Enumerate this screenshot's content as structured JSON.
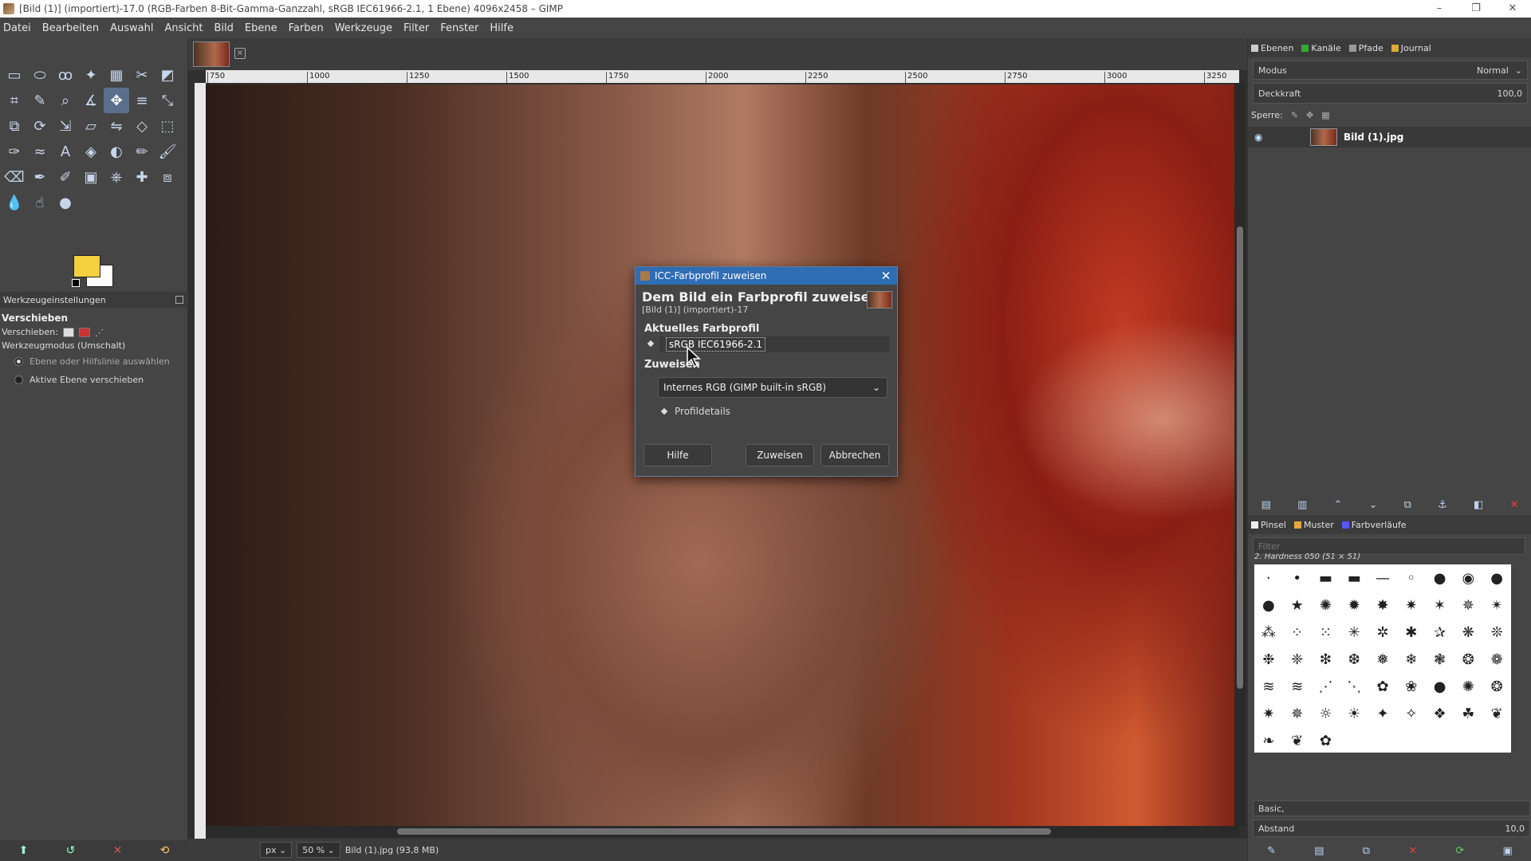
{
  "window": {
    "title": "[Bild (1)] (importiert)-17.0 (RGB-Farben 8-Bit-Gamma-Ganzzahl, sRGB IEC61966-2.1, 1 Ebene) 4096x2458 – GIMP",
    "minimize": "–",
    "maximize": "❐",
    "close": "✕"
  },
  "menu": [
    "Datei",
    "Bearbeiten",
    "Auswahl",
    "Ansicht",
    "Bild",
    "Ebene",
    "Farben",
    "Werkzeuge",
    "Filter",
    "Fenster",
    "Hilfe"
  ],
  "toolbox": {
    "tools": [
      {
        "name": "rect-select-tool",
        "glyph": "▭"
      },
      {
        "name": "ellipse-select-tool",
        "glyph": "⬭"
      },
      {
        "name": "lasso-tool",
        "glyph": "ꝏ"
      },
      {
        "name": "fuzzy-select-tool",
        "glyph": "✦"
      },
      {
        "name": "color-select-tool",
        "glyph": "▦"
      },
      {
        "name": "scissors-tool",
        "glyph": "✂"
      },
      {
        "name": "foreground-select-tool",
        "glyph": "◩"
      },
      {
        "name": "crop-tool",
        "glyph": "⌗"
      },
      {
        "name": "pick-tool",
        "glyph": "✎"
      },
      {
        "name": "zoom-tool",
        "glyph": "⌕"
      },
      {
        "name": "measure-tool",
        "glyph": "∡"
      },
      {
        "name": "move-tool",
        "glyph": "✥"
      },
      {
        "name": "align-tool",
        "glyph": "≡"
      },
      {
        "name": "transform-tool",
        "glyph": "⤡"
      },
      {
        "name": "unified-transform-tool",
        "glyph": "⧉"
      },
      {
        "name": "rotate-tool",
        "glyph": "⟳"
      },
      {
        "name": "scale-tool",
        "glyph": "⇲"
      },
      {
        "name": "shear-tool",
        "glyph": "▱"
      },
      {
        "name": "flip-tool",
        "glyph": "⇋"
      },
      {
        "name": "perspective-tool",
        "glyph": "◇"
      },
      {
        "name": "cage-tool",
        "glyph": "⬚"
      },
      {
        "name": "path-tool",
        "glyph": "✑"
      },
      {
        "name": "warp-tool",
        "glyph": "≈"
      },
      {
        "name": "text-tool",
        "glyph": "A"
      },
      {
        "name": "bucket-fill-tool",
        "glyph": "◈"
      },
      {
        "name": "gradient-tool",
        "glyph": "◐"
      },
      {
        "name": "pencil-tool",
        "glyph": "✏"
      },
      {
        "name": "paintbrush-tool",
        "glyph": "🖌"
      },
      {
        "name": "eraser-tool",
        "glyph": "⌫"
      },
      {
        "name": "airbrush-tool",
        "glyph": "✒"
      },
      {
        "name": "ink-tool",
        "glyph": "✐"
      },
      {
        "name": "mypaint-brush-tool",
        "glyph": "▣"
      },
      {
        "name": "clone-tool",
        "glyph": "⎈"
      },
      {
        "name": "heal-tool",
        "glyph": "✚"
      },
      {
        "name": "perspective-clone-tool",
        "glyph": "⧈"
      },
      {
        "name": "blur-tool",
        "glyph": "💧"
      },
      {
        "name": "smudge-tool",
        "glyph": "☝"
      },
      {
        "name": "dodge-burn-tool",
        "glyph": "●"
      }
    ],
    "options_tab": "Werkzeugeinstellungen",
    "options_title": "Verschieben",
    "move_label": "Verschieben:",
    "mode_label": "Werkzeugmodus (Umschalt)",
    "radio1": "Ebene oder Hilfslinie auswählen",
    "radio2": "Aktive Ebene verschieben",
    "fg_color": "#f4d03f",
    "bg_color": "#ffffff"
  },
  "canvas": {
    "ruler_ticks": [
      "750",
      "1000",
      "1250",
      "1500",
      "1750",
      "2000",
      "2250",
      "2500",
      "2750",
      "3000",
      "3250"
    ],
    "unit": "px",
    "zoom": "50 %",
    "status": "Bild (1).jpg (93,8 MB)"
  },
  "dialog": {
    "title": "ICC-Farbprofil zuweisen",
    "heading": "Dem Bild ein Farbprofil zuweisen",
    "subheading": "[Bild (1)] (importiert)-17",
    "current_label": "Aktuelles Farbprofil",
    "current_value": "sRGB IEC61966-2.1",
    "assign_label": "Zuweisen",
    "assign_value": "Internes RGB (GIMP built-in sRGB)",
    "details_label": "Profildetails",
    "help_button": "Hilfe",
    "assign_button": "Zuweisen",
    "cancel_button": "Abbrechen",
    "title_color": "#2f6db5"
  },
  "layers_dock": {
    "tabs": [
      "Ebenen",
      "Kanäle",
      "Pfade",
      "Journal"
    ],
    "mode_label": "Modus",
    "mode_value": "Normal",
    "opacity_label": "Deckkraft",
    "opacity_value": "100,0",
    "lock_label": "Sperre:",
    "layer_name": "Bild (1).jpg"
  },
  "brushes_dock": {
    "tabs": [
      "Pinsel",
      "Muster",
      "Farbverläufe"
    ],
    "filter_placeholder": "Filter",
    "brush_name": "2. Hardness 050 (51 × 51)",
    "preset": "Basic,",
    "spacing_label": "Abstand",
    "spacing_value": "10,0"
  }
}
